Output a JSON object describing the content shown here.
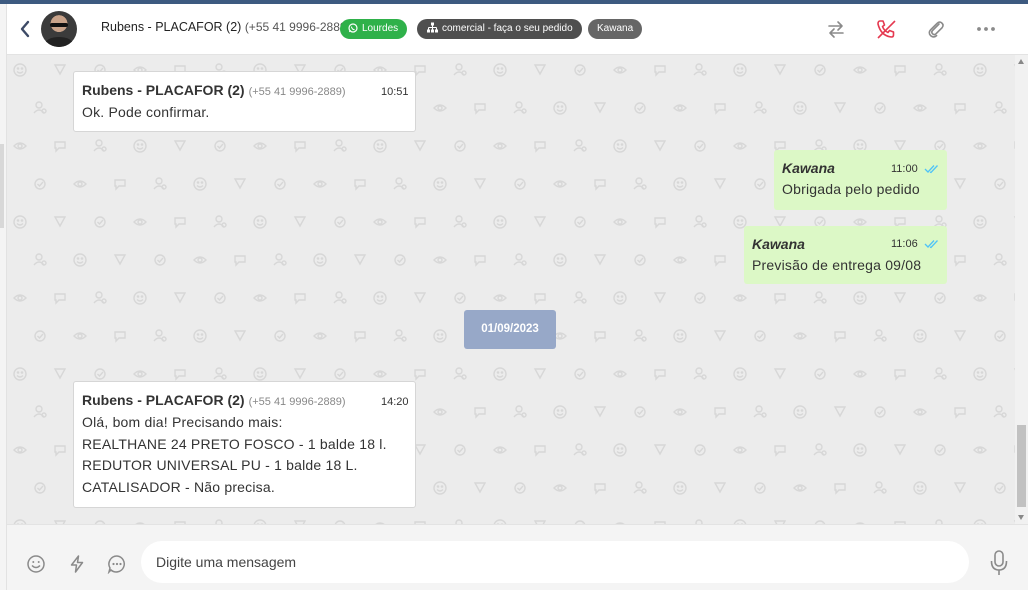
{
  "header": {
    "contact_name": "Rubens - PLACAFOR (2)",
    "contact_phone": "(+55 41 9996-2889)",
    "tags": [
      {
        "label": "Lourdes",
        "color": "#2fb14a",
        "icon": "whatsapp-icon"
      },
      {
        "label": "comercial - faça o seu pedido",
        "color": "#4f4f4f",
        "icon": "sitemap-icon"
      },
      {
        "label": "Kawana",
        "color": "#666666"
      }
    ],
    "actions": [
      "transfer-icon",
      "hangup-phone-icon",
      "paperclip-icon",
      "more-icon"
    ]
  },
  "messages": [
    {
      "direction": "in",
      "sender": "Rubens - PLACAFOR (2)",
      "phone": "(+55 41 9996-2889)",
      "time": "10:51",
      "lines": [
        "Ok. Pode confirmar."
      ]
    },
    {
      "direction": "out",
      "sender": "Kawana",
      "time": "11:00",
      "lines": [
        "Obrigada pelo pedido"
      ]
    },
    {
      "direction": "out",
      "sender": "Kawana",
      "time": "11:06",
      "lines": [
        "Previsão de entrega 09/08"
      ]
    },
    {
      "direction": "in",
      "sender": "Rubens - PLACAFOR (2)",
      "phone": "(+55 41 9996-2889)",
      "time": "14:20",
      "lines": [
        "Olá, bom dia! Precisando mais:",
        "REALTHANE 24 PRETO FOSCO - 1 balde 18 l.",
        "REDUTOR UNIVERSAL PU - 1 balde 18 L.",
        "CATALISADOR - Não precisa."
      ]
    }
  ],
  "date_separator": "01/09/2023",
  "composer": {
    "placeholder": "Digite uma mensagem",
    "left_icons": [
      "emoji-icon",
      "lightning-icon",
      "quick-reply-icon"
    ],
    "right_icon": "microphone-icon"
  },
  "colors": {
    "accent_bar": "#3d5a80",
    "outgoing_bubble": "#dcf8c6",
    "incoming_bubble": "#ffffff",
    "chat_background": "#ececec",
    "date_pill": "#97a8c8",
    "read_ticks": "#4fc3f7",
    "hangup": "#e53950"
  }
}
